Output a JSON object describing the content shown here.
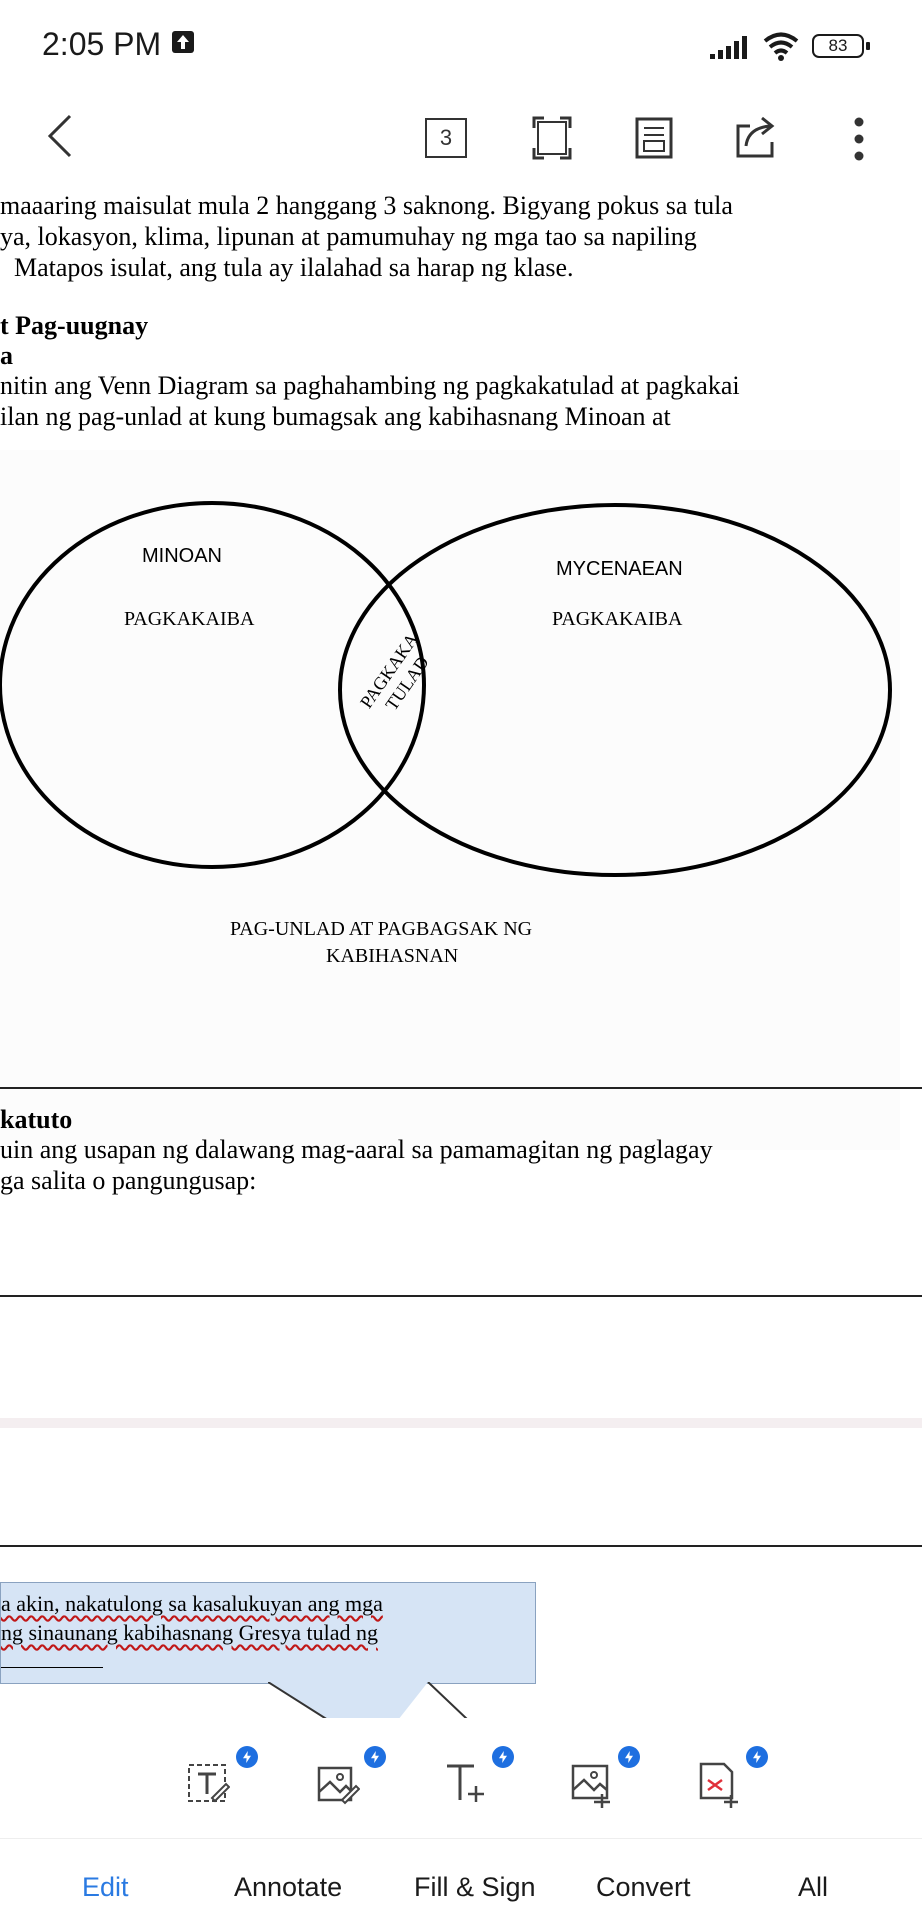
{
  "status_bar": {
    "time": "2:05 PM",
    "battery": "83"
  },
  "toolbar": {
    "page_number": "3"
  },
  "document": {
    "para_lines": [
      "maaaring maisulat mula 2 hanggang 3 saknong. Bigyang pokus sa tula",
      "ya, lokasyon, klima, lipunan at pamumuhay ng mga tao sa napiling",
      "Matapos isulat, ang tula ay ilalahad sa harap ng klase."
    ],
    "heading": "t Pag-uugnay",
    "subheading": "a",
    "instr_lines": [
      "nitin ang Venn Diagram sa paghahambing ng pagkakatulad at pagkakai",
      "ilan ng pag-unlad at kung bumagsak  ang kabihasnang Minoan at"
    ],
    "venn": {
      "left_title": "MINOAN",
      "left_sub": "PAGKAKAIBA",
      "right_title": "MYCENAEAN",
      "right_sub": "PAGKAKAIBA",
      "center_line1": "PAGKAKA",
      "center_line2": "TULAD",
      "caption_line1": "PAG-UNLAD AT PAGBAGSAK NG",
      "caption_line2": "KABIHASNAN"
    },
    "section2_heading": "katuto",
    "section2_lines": [
      "uin ang usapan ng dalawang mag-aaral sa pamamagitan ng paglagay",
      "ga salita o pangungusap:"
    ],
    "bubble_lines": [
      "a akin, nakatulong sa kasalukuyan ang mga",
      "ng sinaunang kabihasnang Gresya tulad ng"
    ]
  },
  "bottom_tools": [
    {
      "name": "edit-text-icon"
    },
    {
      "name": "edit-image-icon"
    },
    {
      "name": "add-text-icon"
    },
    {
      "name": "add-image-icon"
    },
    {
      "name": "add-signature-icon"
    }
  ],
  "tabs": [
    "Edit",
    "Annotate",
    "Fill & Sign",
    "Convert",
    "All"
  ],
  "colors": {
    "accent": "#2a7ae2",
    "premium": "#1e6fe0",
    "bubble": "#d6e4f5"
  }
}
